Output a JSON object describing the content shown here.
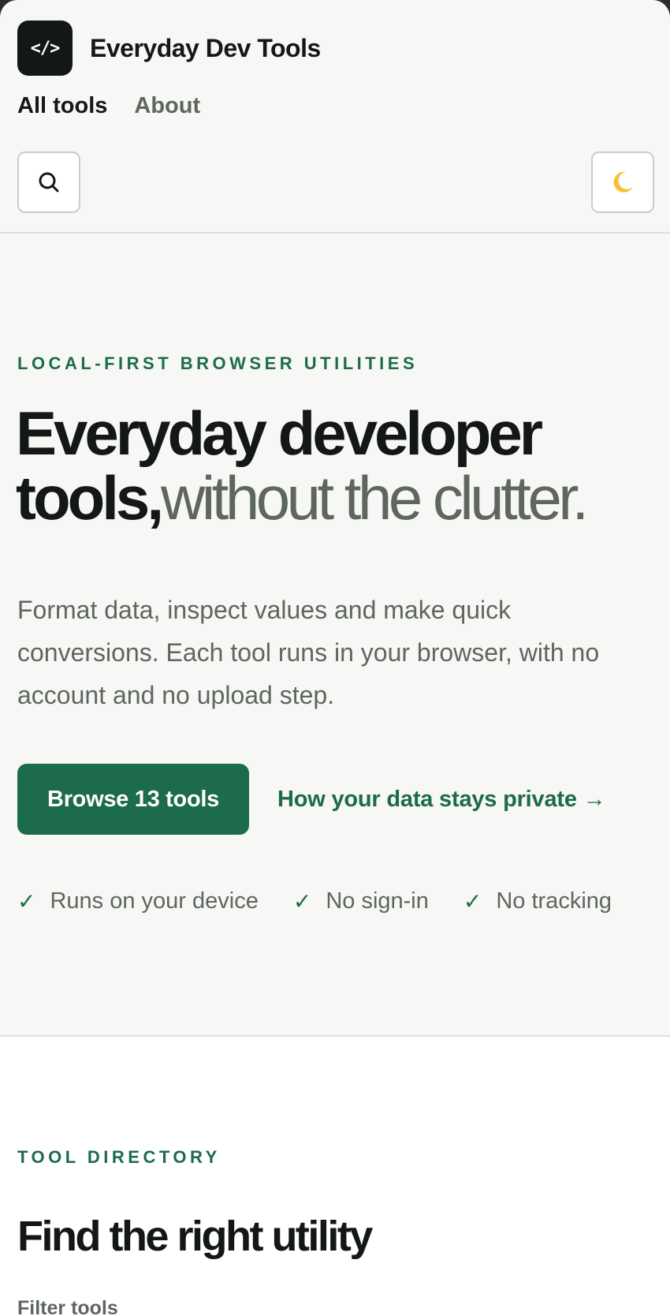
{
  "header": {
    "logo_text": "</>",
    "app_name": "Everyday Dev Tools",
    "nav": [
      {
        "label": "All tools",
        "active": true
      },
      {
        "label": "About",
        "active": false
      }
    ],
    "search_icon": "search-icon",
    "theme_icon": "moon-icon"
  },
  "hero": {
    "eyebrow": "LOCAL-FIRST BROWSER UTILITIES",
    "headline_strong": "Everyday developer tools,",
    "headline_muted": "without the clutter.",
    "lede": "Format data, inspect values and make quick conversions. Each tool runs in your browser, with no account and no upload step.",
    "primary_cta": "Browse 13 tools",
    "secondary_cta": "How your data stays private →",
    "checks": [
      "Runs on your device",
      "No sign-in",
      "No tracking"
    ],
    "check_glyph": "✓"
  },
  "directory": {
    "eyebrow": "TOOL DIRECTORY",
    "title": "Find the right utility",
    "filter_label": "Filter tools"
  },
  "colors": {
    "accent": "#1c6b4a",
    "ink": "#141815",
    "muted": "#5e6660",
    "background": "#f7f7f5",
    "surface": "#ffffff",
    "moon": "#f2c230"
  }
}
